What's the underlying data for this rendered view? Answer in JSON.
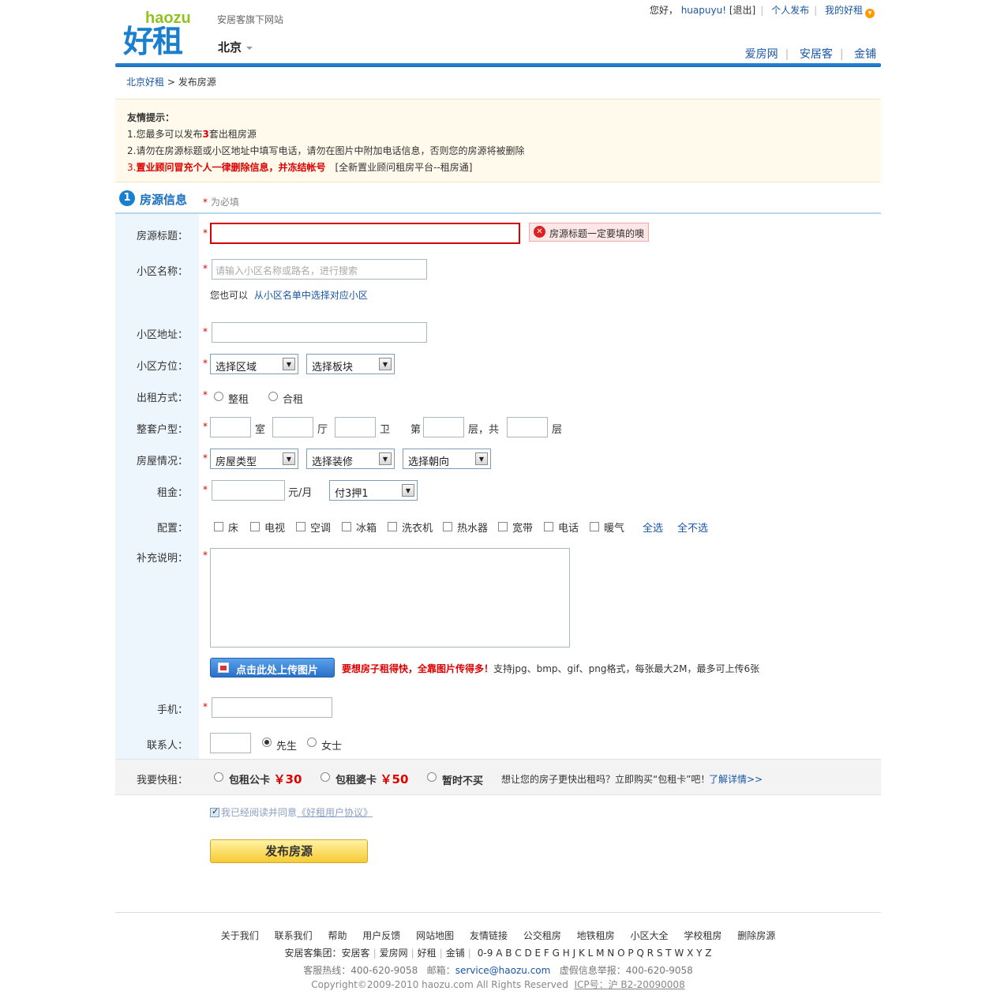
{
  "header": {
    "logo_en": "haozu",
    "logo_cn": "好租",
    "slogan": "安居客旗下网站",
    "city": "北京",
    "greeting": "您好，",
    "username": "huapuyu!",
    "logout": "[退出]",
    "publish": "个人发布",
    "my_haozu": "我的好租",
    "sites": [
      "爱房网",
      "安居客",
      "金铺"
    ]
  },
  "breadcrumb": {
    "home": "北京好租",
    "sep": ">",
    "current": "发布房源"
  },
  "tips": {
    "title": "友情提示：",
    "line1_pre": "1.您最多可以发布",
    "line1_num": "3",
    "line1_post": "套出租房源",
    "line2": "2.请勿在房源标题或小区地址中填写电话，请勿在图片中附加电话信息，否则您的房源将被删除",
    "line3_num": "3.",
    "line3_red": "置业顾问冒充个人一律删除信息，并冻结帐号",
    "line3_post": "[全新置业顾问租房平台--租房通]"
  },
  "section": {
    "num": "1",
    "title": "房源信息",
    "star": "*",
    "required": "为必填"
  },
  "form": {
    "star": "*",
    "title_label": "房源标题：",
    "title_error": "房源标题一定要填的噢",
    "community_label": "小区名称：",
    "community_placeholder": "请输入小区名称或路名，进行搜索",
    "community_alt_pre": "您也可以",
    "community_alt_link": "从小区名单中选择对应小区",
    "address_label": "小区地址：",
    "location_label": "小区方位：",
    "district_select": "选择区域",
    "block_select": "选择板块",
    "rent_type_label": "出租方式：",
    "rent_whole": "整租",
    "rent_shared": "合租",
    "layout_label": "整套户型：",
    "unit_room": "室",
    "unit_hall": "厅",
    "unit_bath": "卫",
    "floor_pre": "第",
    "floor_mid": "层，共",
    "floor_post": "层",
    "house_label": "房屋情况：",
    "house_type_select": "房屋类型",
    "decor_select": "选择装修",
    "orient_select": "选择朝向",
    "rent_label": "租金：",
    "rent_unit": "元/月",
    "pay_select": "付3押1",
    "equip_label": "配置：",
    "equipment": [
      "床",
      "电视",
      "空调",
      "冰箱",
      "洗衣机",
      "热水器",
      "宽带",
      "电话",
      "暖气"
    ],
    "select_all": "全选",
    "select_none": "全不选",
    "desc_label": "补充说明：",
    "upload_btn": "点击此处上传图片",
    "upload_tip_red": "要想房子租得快，全靠图片传得多！",
    "upload_tip": "支持jpg、bmp、gif、png格式，每张最大2M，最多可上传6张",
    "phone_label": "手机：",
    "contact_label": "联系人：",
    "mr": "先生",
    "ms": "女士"
  },
  "quick": {
    "label": "我要快租：",
    "opt1": "包租公卡",
    "price1": "￥30",
    "opt2": "包租婆卡",
    "price2": "￥50",
    "opt3": "暂时不买",
    "tip": "想让您的房子更快出租吗？立即购买“包租卡”吧！",
    "more": "了解详情>>"
  },
  "agree": {
    "pre": "我已经阅读并同意",
    "link": "《好租用户协议》"
  },
  "submit": "发布房源",
  "footer": {
    "links": [
      "关于我们",
      "联系我们",
      "帮助",
      "用户反馈",
      "网站地图",
      "友情链接",
      "公交租房",
      "地铁租房",
      "小区大全",
      "学校租房",
      "删除房源"
    ],
    "group_label": "安居客集团：",
    "group": [
      "安居客",
      "爱房网",
      "好租",
      "金铺"
    ],
    "letters": "0-9 A B C D E F G H J K L M N O P Q R S T W X Y Z",
    "hotline_label": "客服热线：",
    "hotline": "400-620-9058",
    "email_label": "邮箱：",
    "email": "service@haozu.com",
    "report_label": "虚假信息举报：",
    "report": "400-620-9058",
    "copyright": "Copyright©2009-2010 haozu.com All Rights Reserved",
    "icp": "ICP号：沪 B2-20090008"
  },
  "colors": {
    "brand_blue": "#1b7fcf",
    "accent_green": "#8fc31f",
    "error_red": "#d80000"
  }
}
